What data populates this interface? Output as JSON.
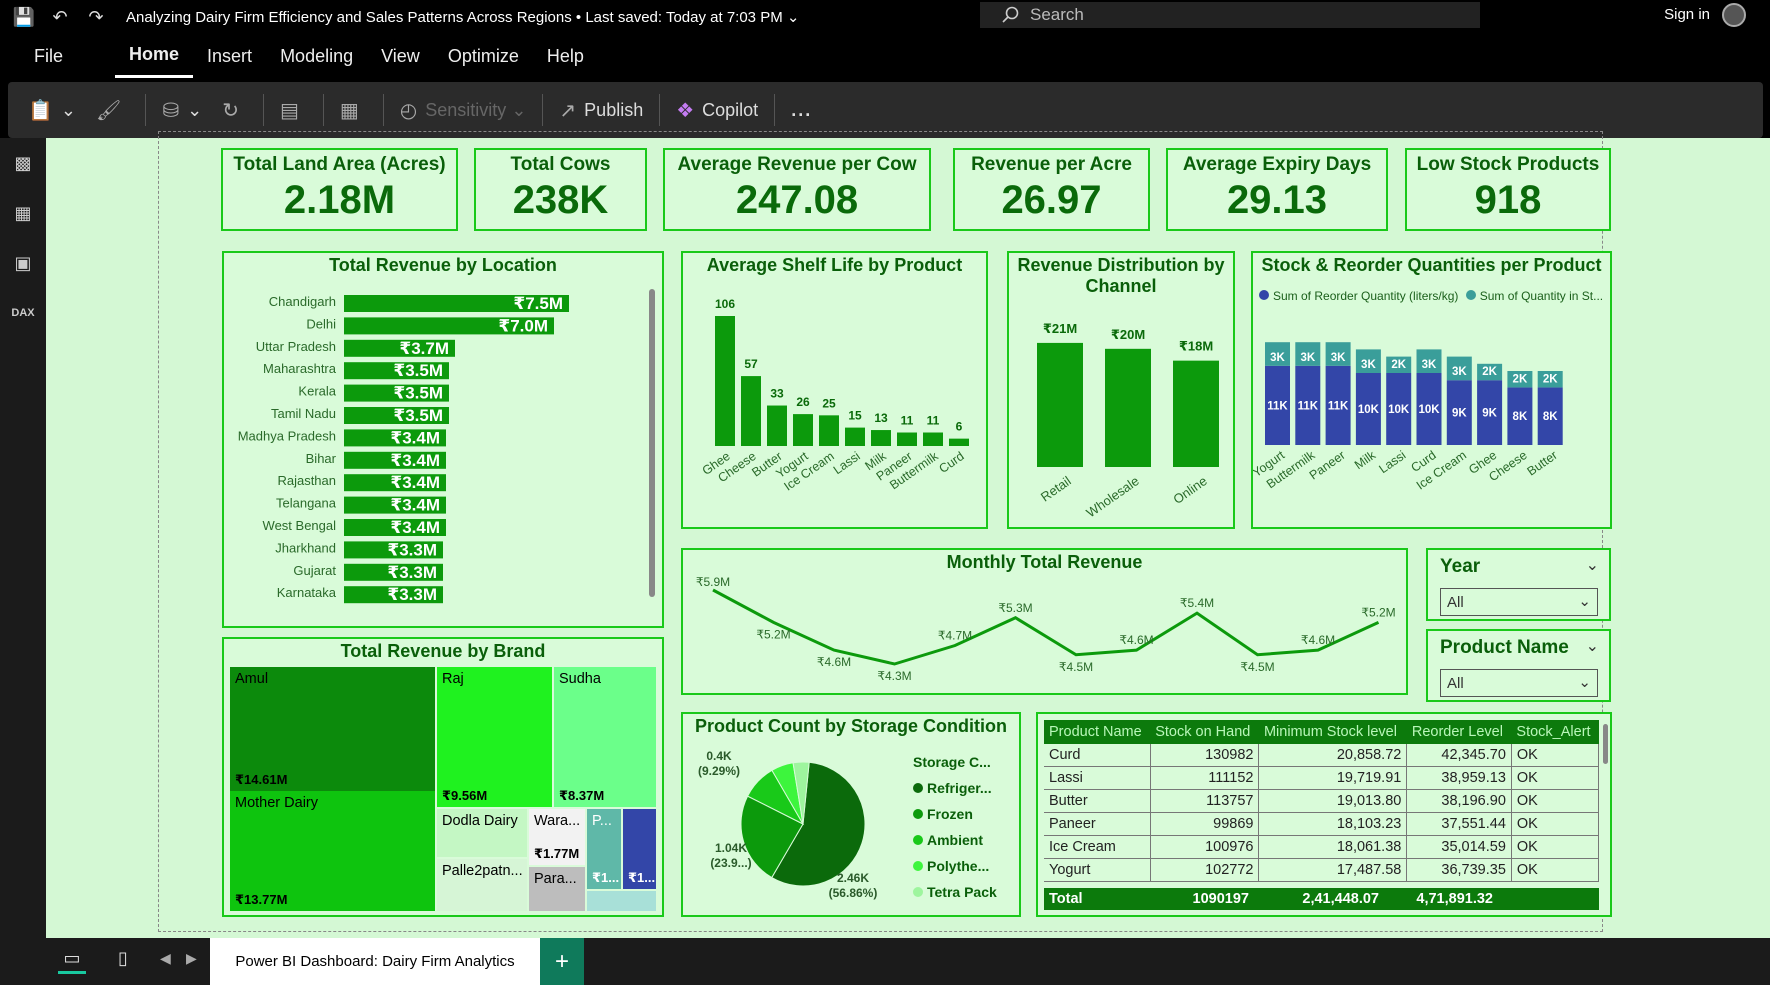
{
  "app": {
    "doc_title": "Analyzing Dairy Firm Efficiency and Sales Patterns Across Regions",
    "saved": "Last saved: Today at 7:03 PM",
    "search_placeholder": "Search",
    "signin": "Sign in"
  },
  "menu": [
    "File",
    "Home",
    "Insert",
    "Modeling",
    "View",
    "Optimize",
    "Help"
  ],
  "ribbon": {
    "sensitivity": "Sensitivity",
    "publish": "Publish",
    "copilot": "Copilot",
    "more": "..."
  },
  "kpis": [
    {
      "title": "Total Land Area (Acres)",
      "value": "2.18M"
    },
    {
      "title": "Total Cows",
      "value": "238K"
    },
    {
      "title": "Average Revenue per Cow",
      "value": "247.08"
    },
    {
      "title": "Revenue per Acre",
      "value": "26.97"
    },
    {
      "title": "Average Expiry Days",
      "value": "29.13"
    },
    {
      "title": "Low Stock Products",
      "value": "918"
    }
  ],
  "chart_data": [
    {
      "id": "location",
      "type": "bar",
      "title": "Total Revenue by Location",
      "categories": [
        "Chandigarh",
        "Delhi",
        "Uttar Pradesh",
        "Maharashtra",
        "Kerala",
        "Tamil Nadu",
        "Madhya Pradesh",
        "Bihar",
        "Rajasthan",
        "Telangana",
        "West Bengal",
        "Jharkhand",
        "Gujarat",
        "Karnataka"
      ],
      "values": [
        7.5,
        7.0,
        3.7,
        3.5,
        3.5,
        3.5,
        3.4,
        3.4,
        3.4,
        3.4,
        3.4,
        3.3,
        3.3,
        3.3
      ],
      "labels": [
        "₹7.5M",
        "₹7.0M",
        "₹3.7M",
        "₹3.5M",
        "₹3.5M",
        "₹3.5M",
        "₹3.4M",
        "₹3.4M",
        "₹3.4M",
        "₹3.4M",
        "₹3.4M",
        "₹3.3M",
        "₹3.3M",
        "₹3.3M"
      ],
      "color": "#0c9a0c"
    },
    {
      "id": "shelf",
      "type": "bar",
      "title": "Average Shelf Life by Product",
      "categories": [
        "Ghee",
        "Cheese",
        "Butter",
        "Yogurt",
        "Ice Cream",
        "Lassi",
        "Milk",
        "Paneer",
        "Buttermilk",
        "Curd"
      ],
      "values": [
        106,
        57,
        33,
        26,
        25,
        15,
        13,
        11,
        11,
        6
      ],
      "color": "#0c9a0c"
    },
    {
      "id": "channel",
      "type": "bar",
      "title": "Revenue Distribution by Channel",
      "categories": [
        "Retail",
        "Wholesale",
        "Online"
      ],
      "values": [
        21,
        20,
        18
      ],
      "labels": [
        "₹21M",
        "₹20M",
        "₹18M"
      ],
      "color": "#0c9a0c"
    },
    {
      "id": "stock",
      "type": "bar",
      "title": "Stock & Reorder Quantities per Product",
      "categories": [
        "Yogurt",
        "Buttermilk",
        "Paneer",
        "Milk",
        "Lassi",
        "Curd",
        "Ice Cream",
        "Ghee",
        "Cheese",
        "Butter"
      ],
      "series": [
        {
          "name": "Sum of Reorder Quantity (liters/kg)",
          "values": [
            3,
            3,
            3,
            3,
            2,
            3,
            3,
            2,
            2,
            2
          ],
          "labels": [
            "3K",
            "3K",
            "3K",
            "3K",
            "2K",
            "3K",
            "3K",
            "2K",
            "2K",
            "2K"
          ],
          "color": "#3a9e9a"
        },
        {
          "name": "Sum of Quantity in St...",
          "values": [
            11,
            11,
            11,
            10,
            10,
            10,
            9,
            9,
            8,
            8
          ],
          "labels": [
            "11K",
            "11K",
            "11K",
            "10K",
            "10K",
            "10K",
            "9K",
            "9K",
            "8K",
            "8K"
          ],
          "color": "#3346a8"
        }
      ]
    },
    {
      "id": "monthly",
      "type": "line",
      "title": "Monthly Total Revenue",
      "values": [
        5.9,
        5.2,
        4.6,
        4.3,
        4.7,
        5.3,
        4.5,
        4.6,
        5.4,
        4.5,
        4.6,
        5.2
      ],
      "labels": [
        "₹5.9M",
        "₹5.2M",
        "₹4.6M",
        "₹4.3M",
        "₹4.7M",
        "₹5.3M",
        "₹4.5M",
        "₹4.6M",
        "₹5.4M",
        "₹4.5M",
        "₹4.6M",
        "₹5.2M"
      ],
      "color": "#0c9a0c"
    },
    {
      "id": "storage",
      "type": "pie",
      "title": "Product Count by Storage Condition",
      "legend_title": "Storage C...",
      "categories": [
        "Refriger...",
        "Frozen",
        "Ambient",
        "Polythe...",
        "Tetra Pack"
      ],
      "values": [
        2.46,
        1.04,
        0.4,
        0.25,
        0.18
      ],
      "colors": [
        "#0b6a0b",
        "#0c9a0c",
        "#19c919",
        "#3df53d",
        "#9ef59e"
      ],
      "annotations": [
        {
          "value": "2.46K",
          "pct": "(56.86%)"
        },
        {
          "value": "1.04K",
          "pct": "(23.9...)"
        },
        {
          "value": "0.4K",
          "pct": "(9.29%)"
        }
      ]
    },
    {
      "id": "brand",
      "type": "treemap",
      "title": "Total Revenue by Brand",
      "items": [
        {
          "name": "Amul",
          "label": "₹14.61M",
          "color": "#0c8a0c"
        },
        {
          "name": "Mother Dairy",
          "label": "₹13.77M",
          "color": "#0ec40e"
        },
        {
          "name": "Raj",
          "label": "₹9.56M",
          "color": "#1ff21f"
        },
        {
          "name": "Sudha",
          "label": "₹8.37M",
          "color": "#6bff8a"
        },
        {
          "name": "Dodla Dairy",
          "label": "",
          "color": "#c4f7c4"
        },
        {
          "name": "Wara...",
          "label": "₹1.77M",
          "color": "#f2f2f2"
        },
        {
          "name": "P...",
          "label": "₹1...",
          "color": "#5fb8a8"
        },
        {
          "name": "",
          "label": "₹1...",
          "color": "#3346a8"
        },
        {
          "name": "Palle2patn...",
          "label": "",
          "color": "#d6f5d6"
        },
        {
          "name": "Para...",
          "label": "",
          "color": "#bdbdbd"
        },
        {
          "name": "",
          "label": "",
          "color": "#a8e0d8"
        }
      ]
    }
  ],
  "slicers": [
    {
      "title": "Year",
      "value": "All"
    },
    {
      "title": "Product Name",
      "value": "All"
    }
  ],
  "table": {
    "headers": [
      "Product Name",
      "Stock on Hand",
      "Minimum Stock level",
      "Reorder Level",
      "Stock_Alert"
    ],
    "rows": [
      [
        "Curd",
        "130982",
        "20,858.72",
        "42,345.70",
        "OK"
      ],
      [
        "Lassi",
        "111152",
        "19,719.91",
        "38,959.13",
        "OK"
      ],
      [
        "Butter",
        "113757",
        "19,013.80",
        "38,196.90",
        "OK"
      ],
      [
        "Paneer",
        "99869",
        "18,103.23",
        "37,551.44",
        "OK"
      ],
      [
        "Ice Cream",
        "100976",
        "18,061.38",
        "35,014.59",
        "OK"
      ],
      [
        "Yogurt",
        "102772",
        "17,487.58",
        "36,739.35",
        "OK"
      ]
    ],
    "total": [
      "Total",
      "1090197",
      "2,41,448.07",
      "4,71,891.32",
      ""
    ]
  },
  "page_tab": "Power BI Dashboard: Dairy Firm Analytics"
}
